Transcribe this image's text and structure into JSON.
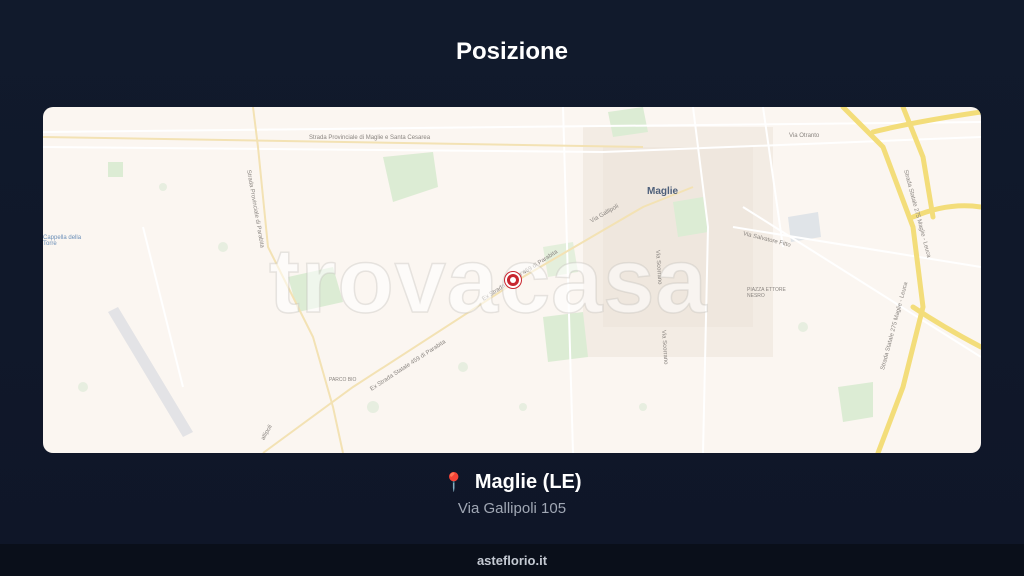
{
  "header": {
    "title": "Posizione"
  },
  "map": {
    "watermark": "trovacasa",
    "town_label": "Maglie",
    "road_labels": {
      "sp_maglie": "Strada Provinciale di Maglie e Santa Cesarea",
      "via_otranto": "Via Otranto",
      "sp_parabita": "Strada Provinciale di Parabita",
      "ex_ss459": "Ex Strada Statale 459 di Parabita",
      "ex_ss459_b": "Ex Strada Statale 459 di Parabita",
      "via_gallipoli_map": "Via Gallipoli",
      "via_scorrano": "Via Scorrano",
      "via_scorrano_b": "Via Scorrano",
      "ss275_a": "Strada Statale 275 Maglie - Leuca",
      "ss275_b": "Strada Statale 275 Maglie - Leuca",
      "via_salvatore": "Via Salvatore Fitto",
      "gallipoli_tail": "allipoli",
      "cappella": "Cappella della Torre",
      "parco": "PARCO BIO",
      "piazza": "PIAZZA ETTORE NESRO"
    }
  },
  "location": {
    "pin_icon": "📍",
    "name": "Maglie (LE)",
    "address": "Via Gallipoli 105"
  },
  "footer": {
    "site": "asteflorio.it"
  },
  "colors": {
    "background": "#111a2c",
    "map_land": "#fbf6f1",
    "highway": "#f3dd7a",
    "marker": "#c8262f"
  }
}
